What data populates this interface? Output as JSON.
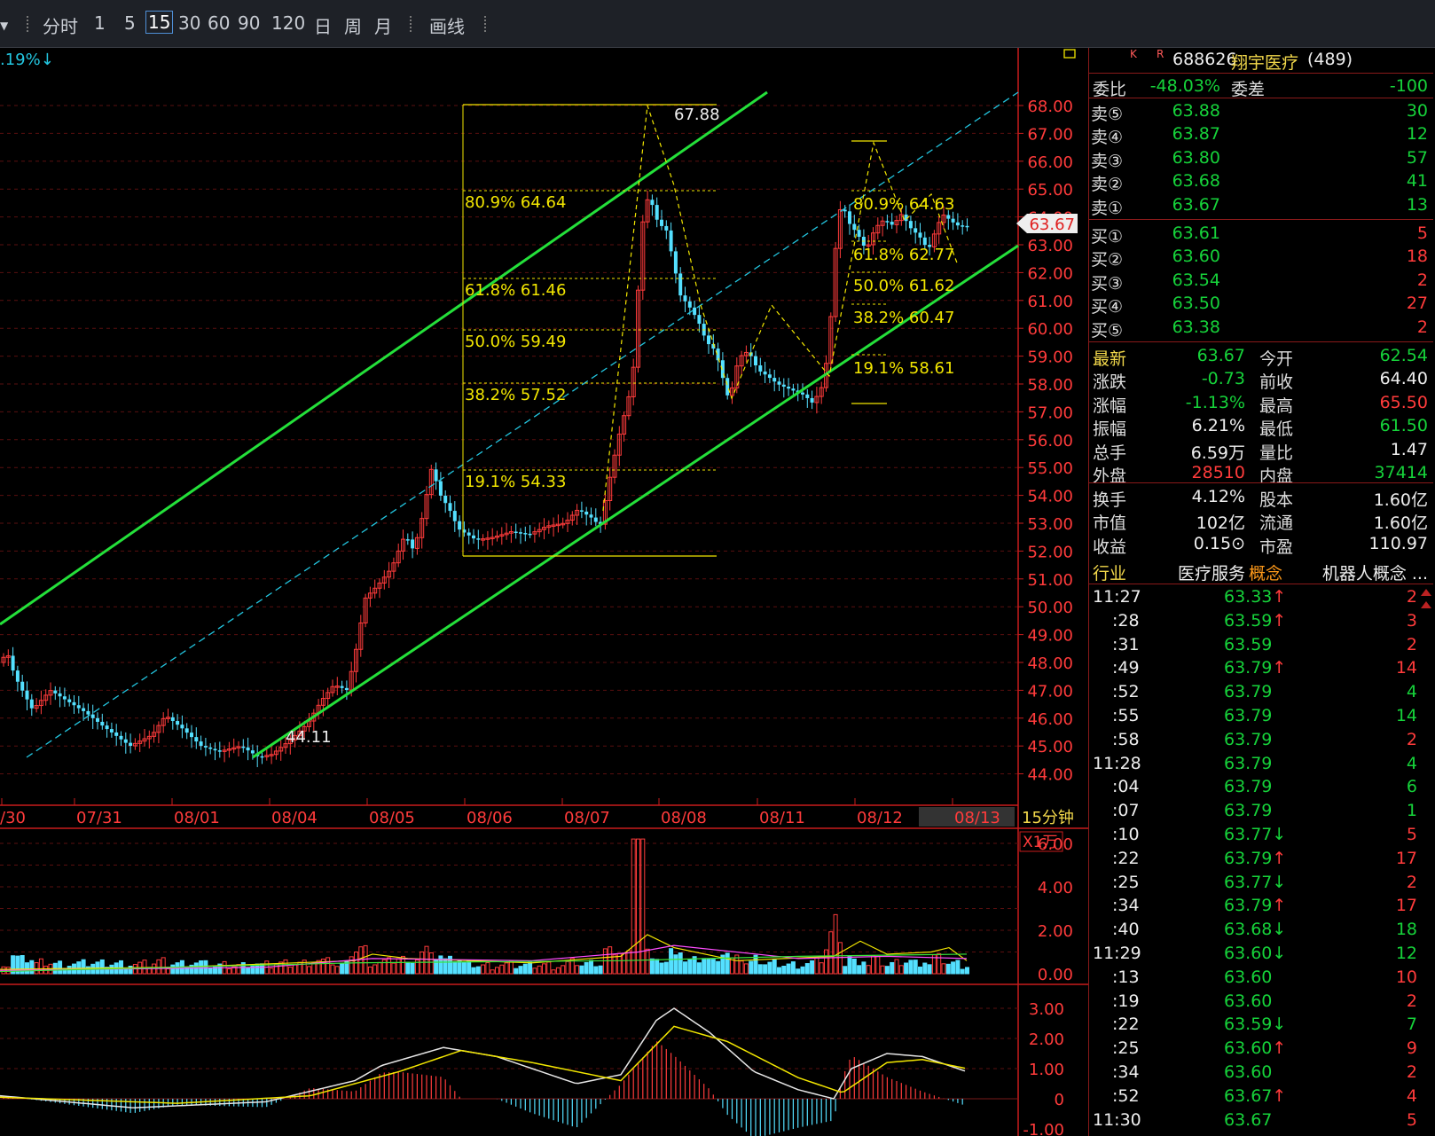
{
  "toolbar": {
    "items": [
      "分时",
      "1",
      "5",
      "15",
      "30",
      "60",
      "90",
      "120",
      "日",
      "周",
      "月",
      "画线"
    ],
    "active": "15"
  },
  "top_left_pct": ".19%↓",
  "price_axis": {
    "labels": [
      "68.00",
      "67.00",
      "66.00",
      "65.00",
      "64.00",
      "63.00",
      "62.00",
      "61.00",
      "60.00",
      "59.00",
      "58.00",
      "57.00",
      "56.00",
      "55.00",
      "54.00",
      "53.00",
      "52.00",
      "51.00",
      "50.00",
      "49.00",
      "48.00",
      "47.00",
      "46.00",
      "45.00",
      "44.00"
    ],
    "current_tag": "63.67"
  },
  "date_axis": {
    "labels": [
      "/30",
      "07/31",
      "08/01",
      "08/04",
      "08/05",
      "08/06",
      "08/07",
      "08/08",
      "08/11",
      "08/12",
      "08/13"
    ],
    "period": "15分钟"
  },
  "annotations": {
    "high": "67.88",
    "low": "44.11",
    "fib1": [
      "80.9% 64.64",
      "61.8% 61.46",
      "50.0% 59.49",
      "38.2% 57.52",
      "19.1% 54.33"
    ],
    "fib2": [
      "80.9% 64.63",
      "61.8% 62.77",
      "50.0% 61.62",
      "38.2% 60.47",
      "19.1% 58.61"
    ]
  },
  "volume_axis": {
    "unit": "X1万",
    "labels": [
      "6.00",
      "4.00",
      "2.00",
      "0.00"
    ]
  },
  "macd_axis": {
    "labels": [
      "3.00",
      "2.00",
      "1.00",
      "0",
      "-1.00"
    ]
  },
  "colors": {
    "up": "#ff3b3b",
    "down": "#54e0ff",
    "channel": "#24e03a",
    "fib": "#f2e600",
    "axis_red": "#c81c1c"
  },
  "stock": {
    "icons": [
      "K",
      "R"
    ],
    "code": "688626",
    "name": "翔宇医疗",
    "count": "(489)"
  },
  "order_ratio": {
    "label": "委比",
    "value": "-48.03%",
    "diff_label": "委差",
    "diff": "-100"
  },
  "asks": [
    {
      "label": "卖⑤",
      "price": "63.88",
      "vol": "30"
    },
    {
      "label": "卖④",
      "price": "63.87",
      "vol": "12"
    },
    {
      "label": "卖③",
      "price": "63.80",
      "vol": "57"
    },
    {
      "label": "卖②",
      "price": "63.68",
      "vol": "41"
    },
    {
      "label": "卖①",
      "price": "63.67",
      "vol": "13"
    }
  ],
  "bids": [
    {
      "label": "买①",
      "price": "63.61",
      "vol": "5"
    },
    {
      "label": "买②",
      "price": "63.60",
      "vol": "18"
    },
    {
      "label": "买③",
      "price": "63.54",
      "vol": "2"
    },
    {
      "label": "买④",
      "price": "63.50",
      "vol": "27"
    },
    {
      "label": "买⑤",
      "price": "63.38",
      "vol": "2"
    }
  ],
  "quote": [
    {
      "l1": "最新",
      "v1": "63.67",
      "c1": "green",
      "l2": "今开",
      "v2": "62.54",
      "c2": "green"
    },
    {
      "l1": "涨跌",
      "v1": "-0.73",
      "c1": "green",
      "l2": "前收",
      "v2": "64.40",
      "c2": "white"
    },
    {
      "l1": "涨幅",
      "v1": "-1.13%",
      "c1": "green",
      "l2": "最高",
      "v2": "65.50",
      "c2": "red"
    },
    {
      "l1": "振幅",
      "v1": "6.21%",
      "c1": "white",
      "l2": "最低",
      "v2": "61.50",
      "c2": "green"
    },
    {
      "l1": "总手",
      "v1": "6.59万",
      "c1": "white",
      "l2": "量比",
      "v2": "1.47",
      "c2": "white"
    },
    {
      "l1": "外盘",
      "v1": "28510",
      "c1": "red",
      "l2": "内盘",
      "v2": "37414",
      "c2": "green"
    }
  ],
  "fundamentals": [
    {
      "l1": "换手",
      "v1": "4.12%",
      "l2": "股本",
      "v2": "1.60亿"
    },
    {
      "l1": "市值",
      "v1": "102亿",
      "l2": "流通",
      "v2": "1.60亿"
    },
    {
      "l1": "收益",
      "v1": "0.15⊙",
      "l2": "市盈",
      "v2": "110.97"
    }
  ],
  "industry": {
    "label": "行业",
    "value": "医疗服务",
    "concept_label": "概念",
    "concept": "机器人概念 ..."
  },
  "ticks": [
    {
      "t": "11:27",
      "p": "63.33↑",
      "v": "2",
      "c": "green",
      "vc": "red"
    },
    {
      "t": ":28",
      "p": "63.59↑",
      "v": "3",
      "c": "green",
      "vc": "red"
    },
    {
      "t": ":31",
      "p": "63.59",
      "v": "2",
      "c": "green",
      "vc": "red"
    },
    {
      "t": ":49",
      "p": "63.79↑",
      "v": "14",
      "c": "green",
      "vc": "red"
    },
    {
      "t": ":52",
      "p": "63.79",
      "v": "4",
      "c": "green",
      "vc": "green"
    },
    {
      "t": ":55",
      "p": "63.79",
      "v": "14",
      "c": "green",
      "vc": "green"
    },
    {
      "t": ":58",
      "p": "63.79",
      "v": "2",
      "c": "green",
      "vc": "red"
    },
    {
      "t": "11:28",
      "p": "63.79",
      "v": "4",
      "c": "green",
      "vc": "green"
    },
    {
      "t": ":04",
      "p": "63.79",
      "v": "6",
      "c": "green",
      "vc": "green"
    },
    {
      "t": ":07",
      "p": "63.79",
      "v": "1",
      "c": "green",
      "vc": "green"
    },
    {
      "t": ":10",
      "p": "63.77↓",
      "v": "5",
      "c": "green",
      "vc": "red"
    },
    {
      "t": ":22",
      "p": "63.79↑",
      "v": "17",
      "c": "green",
      "vc": "red"
    },
    {
      "t": ":25",
      "p": "63.77↓",
      "v": "2",
      "c": "green",
      "vc": "red"
    },
    {
      "t": ":34",
      "p": "63.79↑",
      "v": "17",
      "c": "green",
      "vc": "red"
    },
    {
      "t": ":40",
      "p": "63.68↓",
      "v": "18",
      "c": "green",
      "vc": "green"
    },
    {
      "t": "11:29",
      "p": "63.60↓",
      "v": "12",
      "c": "green",
      "vc": "green"
    },
    {
      "t": ":13",
      "p": "63.60",
      "v": "10",
      "c": "green",
      "vc": "red"
    },
    {
      "t": ":19",
      "p": "63.60",
      "v": "2",
      "c": "green",
      "vc": "red"
    },
    {
      "t": ":22",
      "p": "63.59↓",
      "v": "7",
      "c": "green",
      "vc": "green"
    },
    {
      "t": ":25",
      "p": "63.60↑",
      "v": "9",
      "c": "green",
      "vc": "red"
    },
    {
      "t": ":34",
      "p": "63.60",
      "v": "2",
      "c": "green",
      "vc": "red"
    },
    {
      "t": ":52",
      "p": "63.67↑",
      "v": "4",
      "c": "green",
      "vc": "red"
    },
    {
      "t": "11:30",
      "p": "63.67",
      "v": "5",
      "c": "green",
      "vc": "red"
    }
  ]
}
